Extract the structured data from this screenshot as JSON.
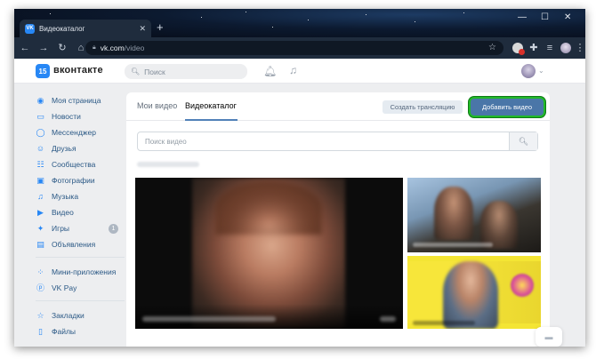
{
  "browser": {
    "tab_title": "Видеокаталог",
    "tab_favicon_text": "VK",
    "url_host": "vk.com",
    "url_path": "/video",
    "controls": {
      "minimize": "—",
      "maximize": "☐",
      "close": "✕"
    }
  },
  "header": {
    "logo_text": "15",
    "brand": "вконтакте",
    "search_placeholder": "Поиск",
    "icons": [
      "bell-icon",
      "music-note-icon",
      "avatar",
      "chevron-down-icon"
    ]
  },
  "sidebar": {
    "items": [
      {
        "label": "Моя страница",
        "icon": "user-circle-icon",
        "glyph": "◉"
      },
      {
        "label": "Новости",
        "icon": "newspaper-icon",
        "glyph": "▭"
      },
      {
        "label": "Мессенджер",
        "icon": "message-bubble-icon",
        "glyph": "◯"
      },
      {
        "label": "Друзья",
        "icon": "friends-icon",
        "glyph": "☺"
      },
      {
        "label": "Сообщества",
        "icon": "communities-icon",
        "glyph": "☷"
      },
      {
        "label": "Фотографии",
        "icon": "photo-icon",
        "glyph": "▣"
      },
      {
        "label": "Музыка",
        "icon": "music-icon",
        "glyph": "♫"
      },
      {
        "label": "Видео",
        "icon": "video-icon",
        "glyph": "▶"
      },
      {
        "label": "Игры",
        "icon": "gamepad-icon",
        "glyph": "✦",
        "badge": "1"
      },
      {
        "label": "Объявления",
        "icon": "ads-icon",
        "glyph": "▤"
      }
    ],
    "group2": [
      {
        "label": "Мини-приложения",
        "icon": "mini-apps-icon",
        "glyph": "⁘"
      },
      {
        "label": "VK Pay",
        "icon": "vkpay-icon",
        "glyph": "ⓟ"
      }
    ],
    "group3": [
      {
        "label": "Закладки",
        "icon": "star-icon",
        "glyph": "☆"
      },
      {
        "label": "Файлы",
        "icon": "file-icon",
        "glyph": "▯"
      }
    ]
  },
  "main": {
    "tabs": [
      {
        "label": "Мои видео",
        "active": false
      },
      {
        "label": "Видеокаталог",
        "active": true
      }
    ],
    "create_stream_button": "Создать трансляцию",
    "add_video_button": "Добавить видео",
    "search_placeholder": "Поиск видео"
  },
  "colors": {
    "vk_blue": "#2787f5",
    "primary_button": "#4a76a8",
    "highlight_outline": "#21b829",
    "link_text": "#2a5885"
  }
}
